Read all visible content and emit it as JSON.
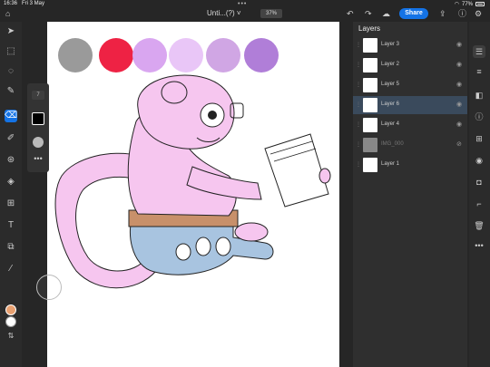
{
  "status": {
    "time": "16:36",
    "date": "Fri 3 May",
    "battery": "77%"
  },
  "toolbar": {
    "doc_title": "Unti...(?) ˅",
    "zoom": "37%",
    "share_label": "Share"
  },
  "brush": {
    "size": "7"
  },
  "colors": {
    "foreground": "#e8a070",
    "background": "#ffffff",
    "accent": "#1473e6",
    "swatches": [
      "#9a9a9a",
      "#ee2244",
      "#d9a6f0",
      "#e9c6f7",
      "#d0a6e4",
      "#b07ed8"
    ]
  },
  "layers_panel": {
    "title": "Layers",
    "layers": [
      {
        "name": "Layer 3",
        "visible": true
      },
      {
        "name": "Layer 2",
        "visible": true
      },
      {
        "name": "Layer 5",
        "visible": true
      },
      {
        "name": "Layer 6",
        "visible": true,
        "selected": true
      },
      {
        "name": "Layer 4",
        "visible": true
      },
      {
        "name": "IMG_000",
        "visible": false
      },
      {
        "name": "Layer 1",
        "visible": true
      }
    ]
  }
}
